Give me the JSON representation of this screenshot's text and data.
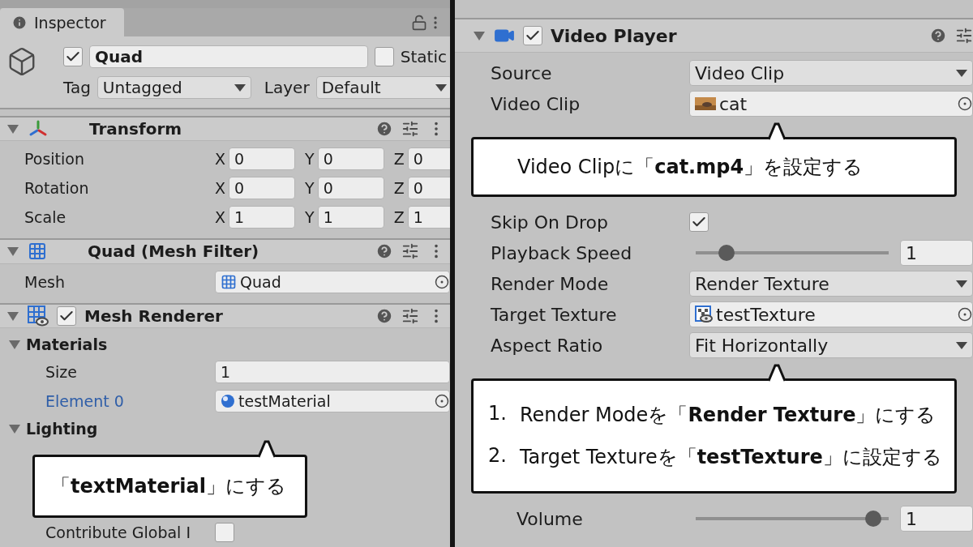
{
  "left": {
    "tab": "Inspector",
    "object": {
      "active": true,
      "name": "Quad",
      "static": false,
      "static_label": "Static",
      "tag_label": "Tag",
      "tag": "Untagged",
      "layer_label": "Layer",
      "layer": "Default"
    },
    "components": [
      {
        "kind": "transform",
        "title": "Transform",
        "rows": [
          {
            "kind": "vector",
            "label": "Position",
            "values": [
              {
                "axis": "X",
                "value": "0"
              },
              {
                "axis": "Y",
                "value": "0"
              },
              {
                "axis": "Z",
                "value": "0"
              }
            ]
          },
          {
            "kind": "vector",
            "label": "Rotation",
            "values": [
              {
                "axis": "X",
                "value": "0"
              },
              {
                "axis": "Y",
                "value": "0"
              },
              {
                "axis": "Z",
                "value": "0"
              }
            ]
          },
          {
            "kind": "vector",
            "label": "Scale",
            "values": [
              {
                "axis": "X",
                "value": "1"
              },
              {
                "axis": "Y",
                "value": "1"
              },
              {
                "axis": "Z",
                "value": "1"
              }
            ]
          }
        ]
      },
      {
        "kind": "mesh_filter",
        "title": "Quad (Mesh Filter)",
        "rows": [
          {
            "kind": "mesh_ref",
            "label": "Mesh",
            "value": "Quad"
          }
        ]
      },
      {
        "kind": "mesh_renderer",
        "title": "Mesh Renderer",
        "enabled": true,
        "rows": [
          {
            "kind": "section",
            "label": "Materials",
            "expanded": true,
            "children": [
              {
                "kind": "text",
                "label": "Size",
                "value": "1"
              },
              {
                "kind": "material_ref",
                "label": "Element 0",
                "value": "testMaterial",
                "highlighted": true
              }
            ]
          },
          {
            "kind": "section",
            "label": "Lighting",
            "expanded": true,
            "children": [
              {
                "kind": "callout",
                "lines": [
                  {
                    "text": "「**textMaterial**」にする"
                  }
                ]
              },
              {
                "kind": "checkbox",
                "label": "Contribute Global I",
                "checked": false
              }
            ]
          }
        ]
      }
    ]
  },
  "right": {
    "components": [
      {
        "kind": "video_player",
        "title": "Video Player",
        "enabled": true,
        "rows": [
          {
            "kind": "dropdown",
            "label": "Source",
            "value": "Video Clip"
          },
          {
            "kind": "video_ref",
            "label": "Video Clip",
            "value": "cat"
          },
          {
            "kind": "callout",
            "lines": [
              {
                "text": "Video Clipに「**cat.mp4**」を設定する"
              }
            ]
          },
          {
            "kind": "checkbox",
            "label": "Skip On Drop",
            "checked": true
          },
          {
            "kind": "slider",
            "label": "Playback Speed",
            "level": 0.13,
            "value": "1"
          },
          {
            "kind": "dropdown",
            "label": "Render Mode",
            "value": "Render Texture"
          },
          {
            "kind": "texture_ref",
            "label": "Target Texture",
            "value": "testTexture"
          },
          {
            "kind": "dropdown",
            "label": "Aspect Ratio",
            "value": "Fit Horizontally"
          },
          {
            "kind": "callout",
            "lines": [
              {
                "number": "1.",
                "text": "Render Modeを「**Render Texture**」にする"
              },
              {
                "number": "2.",
                "text": "Target Textureを「**testTexture**」に設定する"
              }
            ]
          },
          {
            "kind": "group",
            "children": [
              {
                "kind": "slider",
                "label": "Volume",
                "level": 0.96,
                "value": "1"
              }
            ]
          }
        ]
      }
    ]
  }
}
